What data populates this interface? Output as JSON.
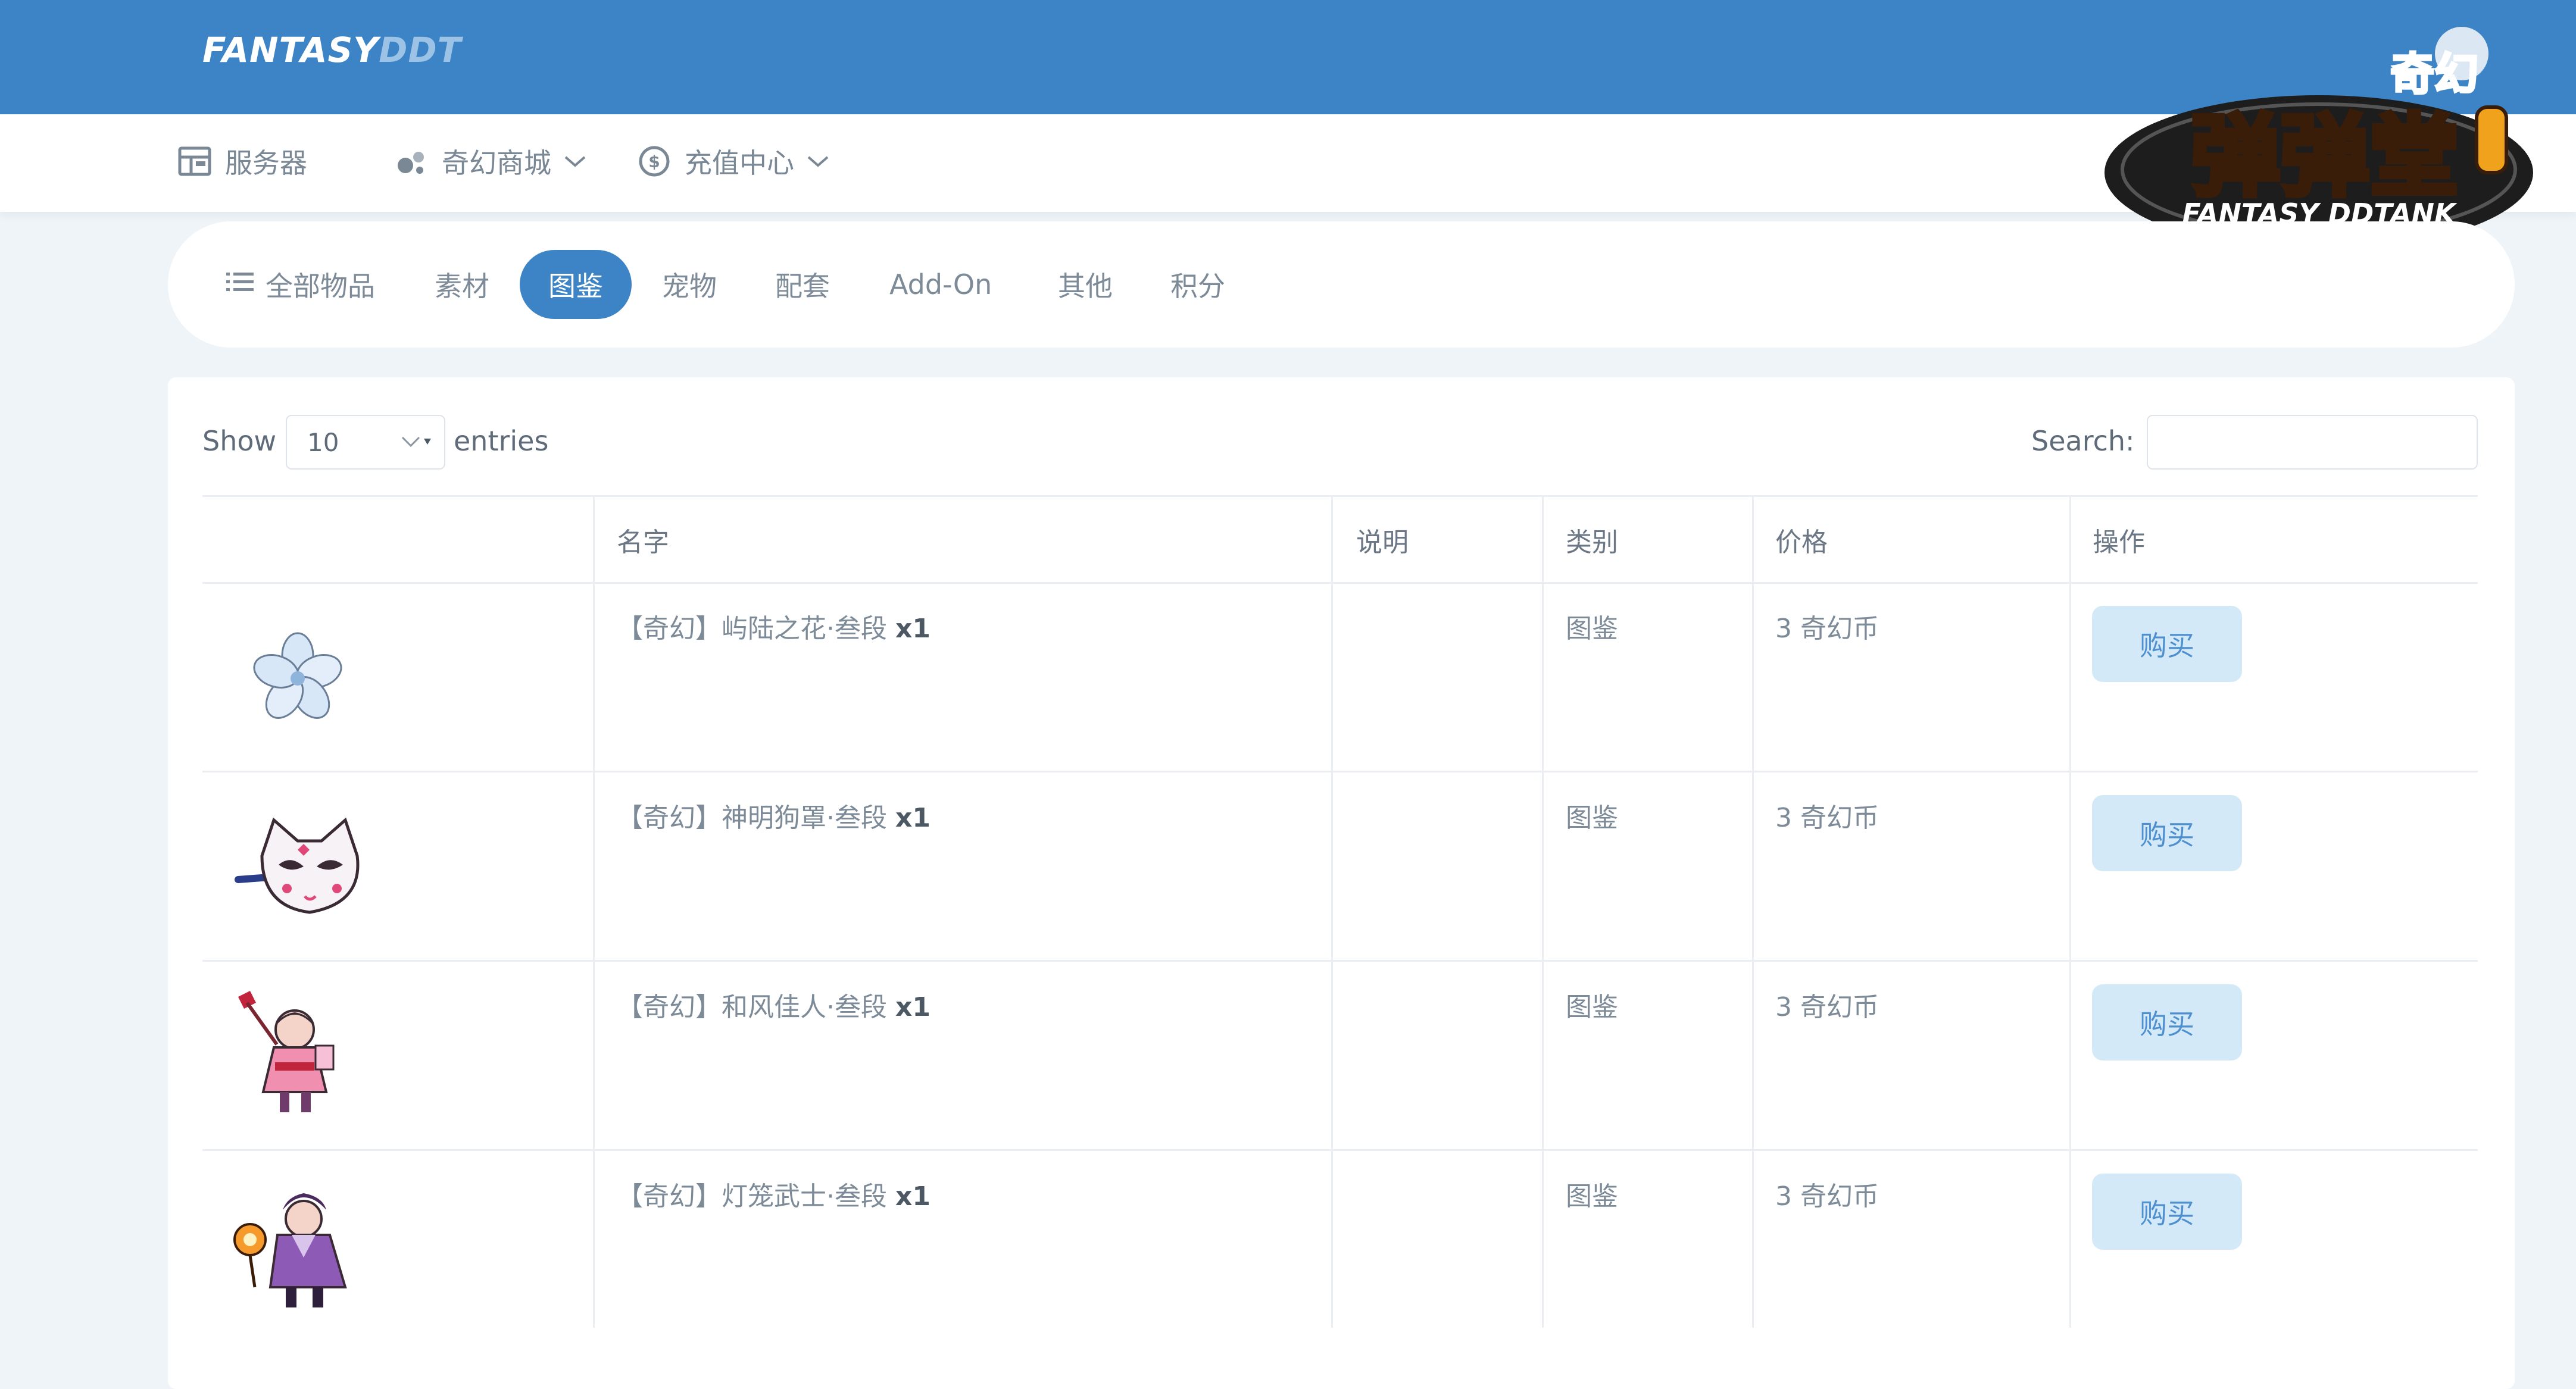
{
  "brand": {
    "part1": "FANTASY",
    "part2": "DDT"
  },
  "nav": [
    {
      "label": "服务器",
      "icon": "layout-icon"
    },
    {
      "label": "奇幻商城",
      "icon": "bubbles-icon"
    },
    {
      "label": "充值中心",
      "icon": "coin-icon"
    }
  ],
  "logo": {
    "top_text": "奇幻",
    "main_text": "弹弹堂",
    "sub_text": "FANTASY DDTANK"
  },
  "tabs": [
    "全部物品",
    "素材",
    "图鉴",
    "宠物",
    "配套",
    "Add-On",
    "其他",
    "积分"
  ],
  "active_tab": "图鉴",
  "table_controls": {
    "show_label": "Show",
    "entries_value": "10",
    "entries_label": "entries",
    "search_label": "Search:",
    "search_value": ""
  },
  "table": {
    "headers": [
      "",
      "名字",
      "说明",
      "类别",
      "价格",
      "操作"
    ],
    "rows": [
      {
        "image": "flower-icon",
        "name": "【奇幻】屿陆之花·叁段",
        "qty": "x1",
        "desc": "",
        "category": "图鉴",
        "price": "3 奇幻币",
        "action": "购买"
      },
      {
        "image": "fox-mask-icon",
        "name": "【奇幻】神明狗罩·叁段",
        "qty": "x1",
        "desc": "",
        "category": "图鉴",
        "price": "3 奇幻币",
        "action": "购买"
      },
      {
        "image": "kimono-girl-icon",
        "name": "【奇幻】和风佳人·叁段",
        "qty": "x1",
        "desc": "",
        "category": "图鉴",
        "price": "3 奇幻币",
        "action": "购买"
      },
      {
        "image": "lantern-warrior-icon",
        "name": "【奇幻】灯笼武士·叁段",
        "qty": "x1",
        "desc": "",
        "category": "图鉴",
        "price": "3 奇幻币",
        "action": "购买"
      }
    ]
  },
  "colors": {
    "primary": "#3d84c6",
    "button_bg": "#d3e9f8",
    "background": "#eef4f8"
  }
}
